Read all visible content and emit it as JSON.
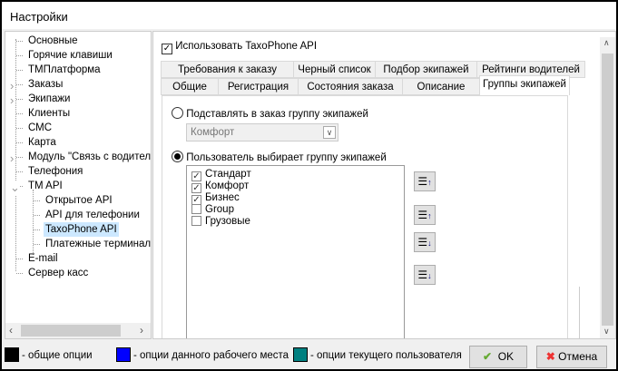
{
  "window": {
    "title": "Настройки"
  },
  "tree": {
    "items": [
      {
        "label": "Основные",
        "level": 0,
        "expander": ""
      },
      {
        "label": "Горячие клавиши",
        "level": 0,
        "expander": ""
      },
      {
        "label": "ТМПлатформа",
        "level": 0,
        "expander": ""
      },
      {
        "label": "Заказы",
        "level": 0,
        "expander": ">"
      },
      {
        "label": "Экипажи",
        "level": 0,
        "expander": ">"
      },
      {
        "label": "Клиенты",
        "level": 0,
        "expander": ""
      },
      {
        "label": "СМС",
        "level": 0,
        "expander": ""
      },
      {
        "label": "Карта",
        "level": 0,
        "expander": ""
      },
      {
        "label": "Модуль \"Связь с водителя",
        "level": 0,
        "expander": ">"
      },
      {
        "label": "Телефония",
        "level": 0,
        "expander": ""
      },
      {
        "label": "TM API",
        "level": 0,
        "expander": "v"
      },
      {
        "label": "Открытое API",
        "level": 1,
        "expander": ""
      },
      {
        "label": "API для телефонии",
        "level": 1,
        "expander": ""
      },
      {
        "label": "TaxoPhone API",
        "level": 1,
        "expander": "",
        "selected": true
      },
      {
        "label": "Платежные терминаль",
        "level": 1,
        "expander": ""
      },
      {
        "label": "E-mail",
        "level": 0,
        "expander": ""
      },
      {
        "label": "Сервер касс",
        "level": 0,
        "expander": ""
      }
    ]
  },
  "main": {
    "use_api": {
      "label": "Использовать TaxoPhone API",
      "checked": true
    },
    "tabs_row1": [
      "Требования к заказу",
      "Черный список",
      "Подбор экипажей",
      "Рейтинги водителей"
    ],
    "tabs_row2": [
      "Общие",
      "Регистрация",
      "Состояния заказа",
      "Описание",
      "Группы экипажей"
    ],
    "active_tab": "Группы экипажей",
    "radio_substitute": {
      "label": "Подставлять в заказ группу экипажей",
      "selected": false
    },
    "combo": {
      "value": "Комфорт"
    },
    "radio_user": {
      "label": "Пользователь выбирает группу экипажей",
      "selected": true
    },
    "groups": [
      {
        "label": "Стандарт",
        "checked": true
      },
      {
        "label": "Комфорт",
        "checked": true
      },
      {
        "label": "Бизнес",
        "checked": true
      },
      {
        "label": "Group",
        "checked": false
      },
      {
        "label": "Грузовые",
        "checked": false
      }
    ],
    "move_buttons": [
      "move-top",
      "move-up",
      "move-down",
      "move-bottom"
    ]
  },
  "legend": [
    {
      "label": "- общие опции",
      "color": "#000000"
    },
    {
      "label": "- опции данного рабочего места",
      "color": "#0000ff"
    },
    {
      "label": "- опции текущего пользователя",
      "color": "#008080"
    }
  ],
  "buttons": {
    "ok": "OK",
    "cancel": "Отмена"
  }
}
